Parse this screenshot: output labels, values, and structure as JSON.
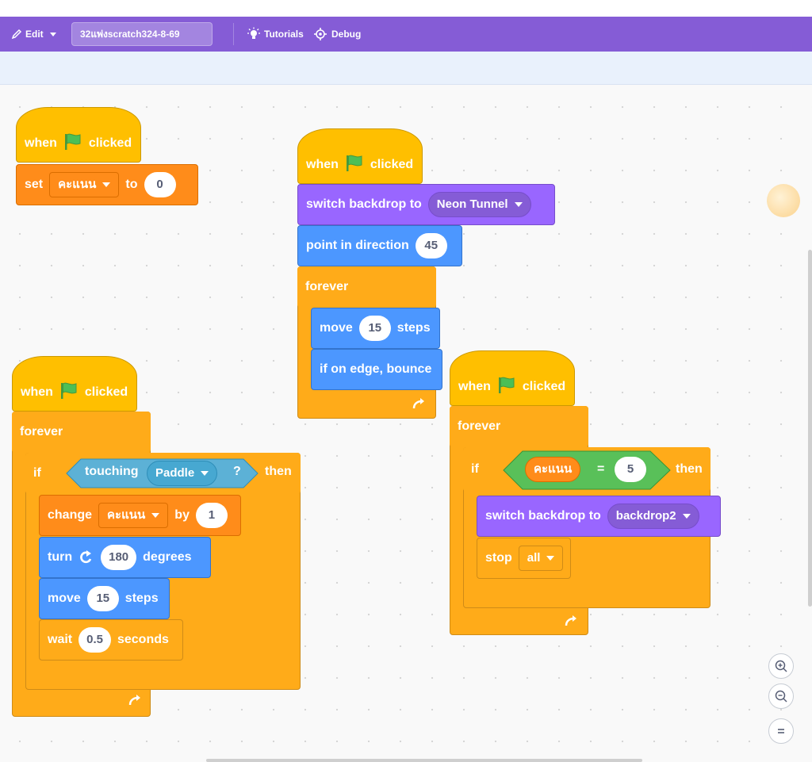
{
  "menubar": {
    "edit_label": "Edit",
    "project_title": "32แพ่งscratch324-8-69",
    "tutorials_label": "Tutorials",
    "debug_label": "Debug"
  },
  "script1": {
    "hat_when": "when",
    "hat_clicked": "clicked",
    "set_label": "set",
    "set_var": "คะแนน",
    "set_to": "to",
    "set_value": "0"
  },
  "script2": {
    "hat_when": "when",
    "hat_clicked": "clicked",
    "switch_label": "switch backdrop to",
    "switch_value": "Neon Tunnel",
    "point_label": "point in direction",
    "point_value": "45",
    "forever_label": "forever",
    "move_label": "move",
    "move_value": "15",
    "move_steps": "steps",
    "bounce_label": "if on edge, bounce"
  },
  "script3": {
    "hat_when": "when",
    "hat_clicked": "clicked",
    "forever_label": "forever",
    "if_label": "if",
    "touching_label": "touching",
    "touching_value": "Paddle",
    "question": "?",
    "then_label": "then",
    "change_label": "change",
    "change_var": "คะแนน",
    "change_by": "by",
    "change_value": "1",
    "turn_label": "turn",
    "turn_value": "180",
    "turn_degrees": "degrees",
    "move_label": "move",
    "move_value": "15",
    "move_steps": "steps",
    "wait_label": "wait",
    "wait_value": "0.5",
    "wait_seconds": "seconds"
  },
  "script4": {
    "hat_when": "when",
    "hat_clicked": "clicked",
    "forever_label": "forever",
    "if_label": "if",
    "eq_var": "คะแนน",
    "eq_op": "=",
    "eq_value": "5",
    "then_label": "then",
    "switch_label": "switch backdrop to",
    "switch_value": "backdrop2",
    "stop_label": "stop",
    "stop_value": "all"
  },
  "colors": {
    "events": "#ffbf00",
    "variables": "#ff8c1a",
    "looks": "#9966ff",
    "motion": "#4c97ff",
    "control": "#ffab19",
    "operators": "#59c059",
    "sensing": "#5cb1d6"
  },
  "icons": [
    "pencil-icon",
    "bulb-icon",
    "debug-icon",
    "green-flag-icon",
    "turn-right-icon",
    "loop-arrow-icon",
    "zoom-in-icon",
    "zoom-out-icon",
    "zoom-reset-icon"
  ]
}
